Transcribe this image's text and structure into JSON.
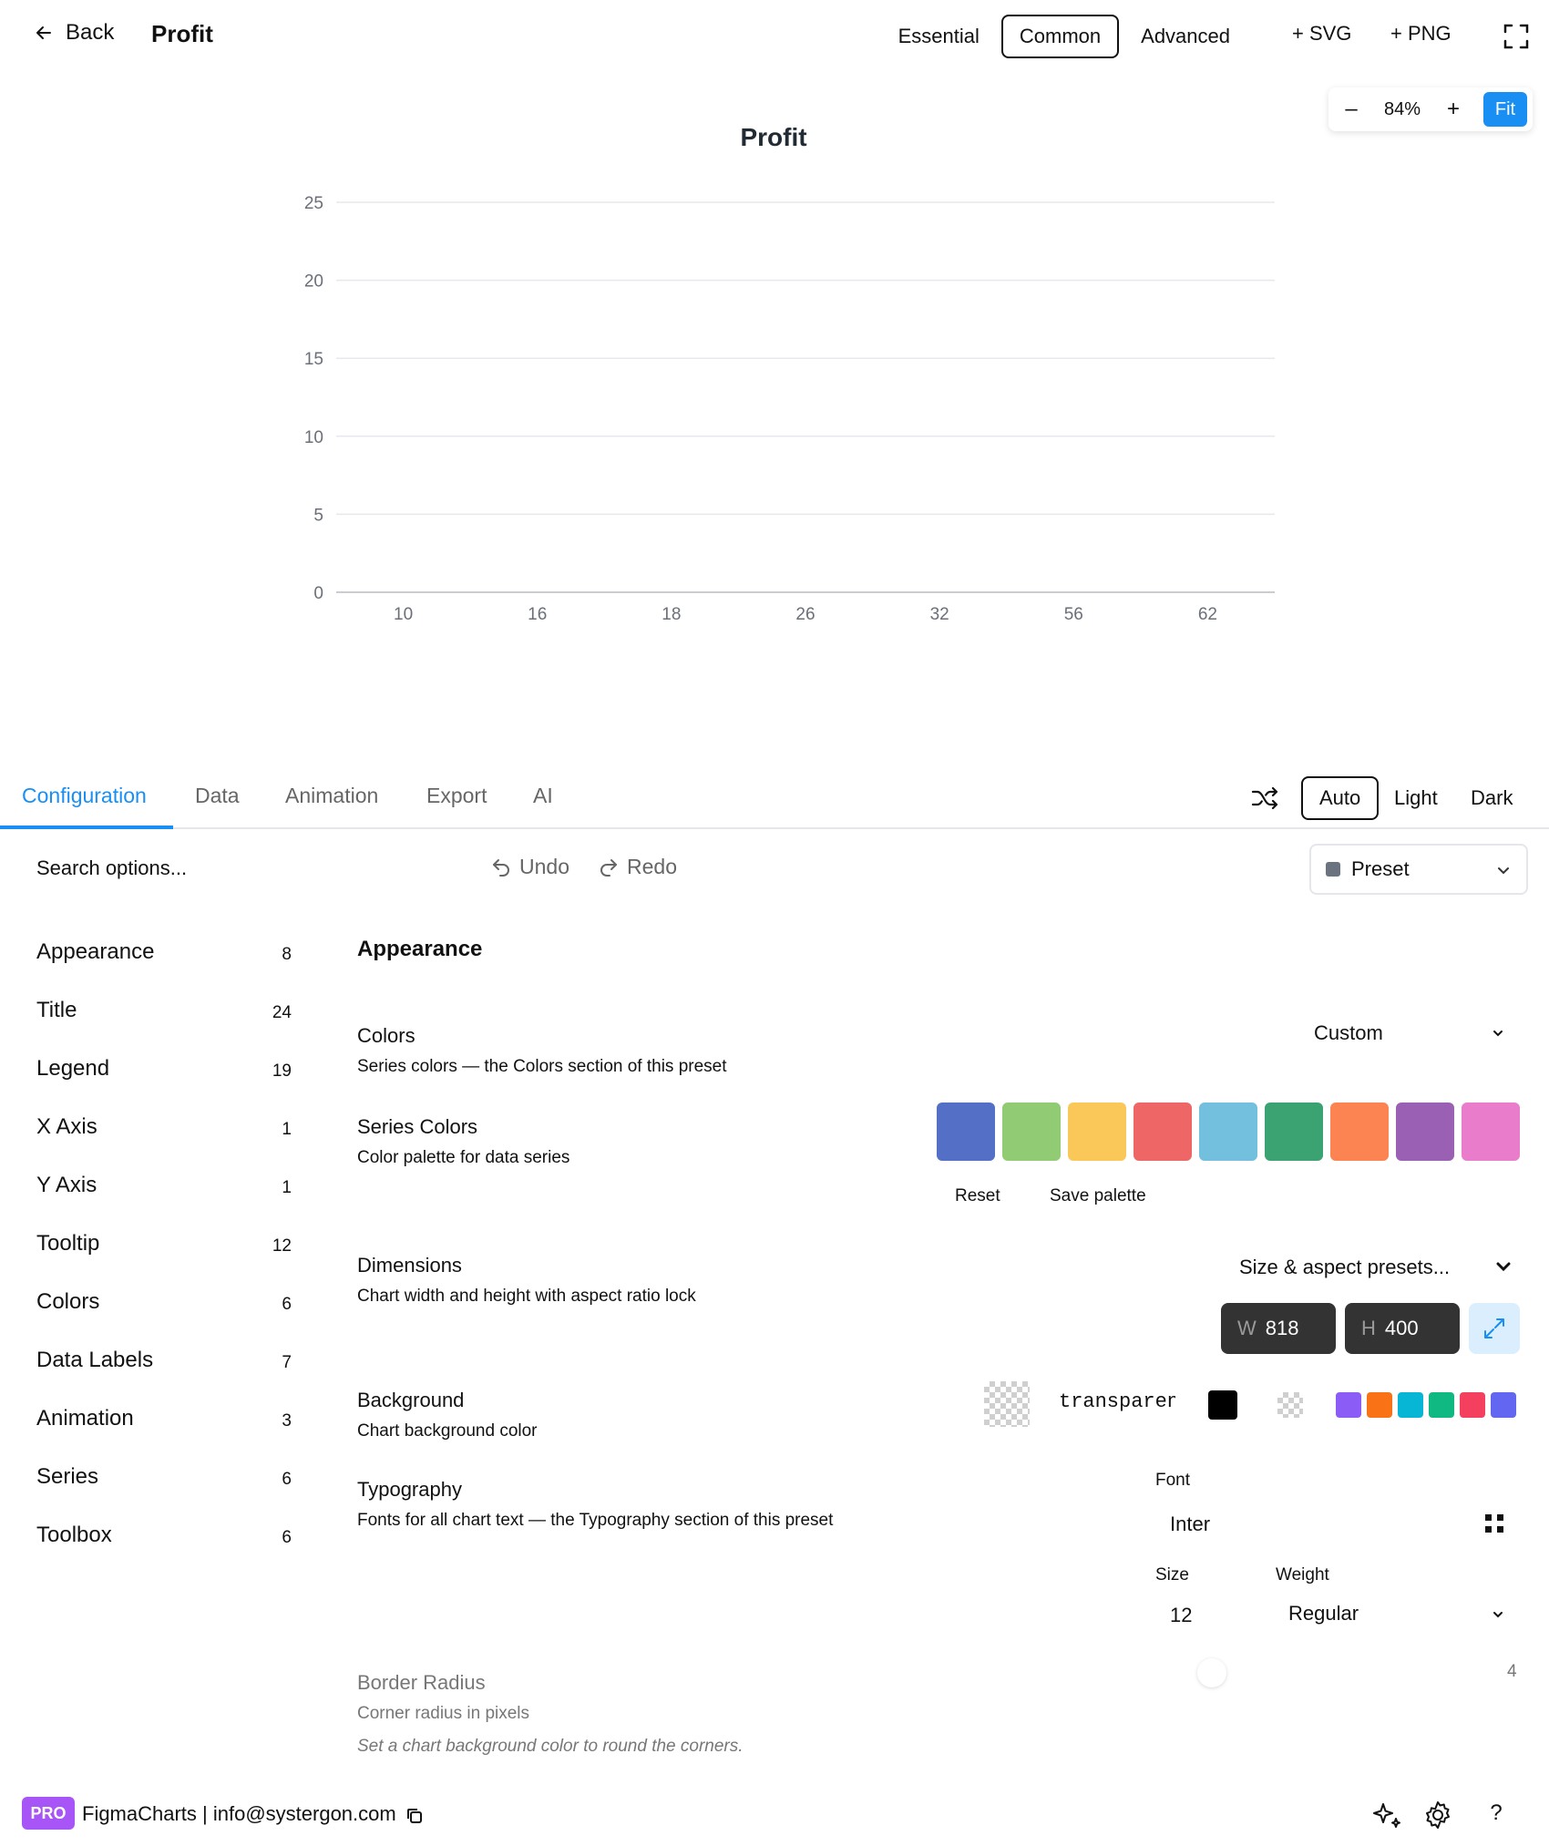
{
  "header": {
    "back_label": "Back",
    "chart_name": "Profit",
    "modes": [
      "Essential",
      "Common",
      "Advanced"
    ],
    "active_mode": "Common",
    "export_svg": "+ SVG",
    "export_png": "+ PNG"
  },
  "zoom": {
    "minus": "–",
    "value": "84%",
    "plus": "+",
    "fit": "Fit"
  },
  "chart_data": {
    "type": "bar",
    "title": "Profit",
    "categories": [
      "10",
      "16",
      "18",
      "26",
      "32",
      "56",
      "62"
    ],
    "values": [
      0,
      0,
      0,
      0,
      0,
      0,
      0
    ],
    "ylim": [
      0,
      25
    ],
    "yticks": [
      "0",
      "5",
      "10",
      "15",
      "20",
      "25"
    ],
    "grid": true
  },
  "panel": {
    "tabs": [
      "Configuration",
      "Data",
      "Animation",
      "Export",
      "AI"
    ],
    "active_tab": "Configuration",
    "themes": [
      "Auto",
      "Light",
      "Dark"
    ],
    "active_theme": "Auto"
  },
  "toolbar": {
    "search_placeholder": "Search options...",
    "undo": "Undo",
    "redo": "Redo",
    "preset": "Preset"
  },
  "sidebar": {
    "items": [
      {
        "label": "Appearance",
        "count": "8"
      },
      {
        "label": "Title",
        "count": "24"
      },
      {
        "label": "Legend",
        "count": "19"
      },
      {
        "label": "X Axis",
        "count": "1"
      },
      {
        "label": "Y Axis",
        "count": "1"
      },
      {
        "label": "Tooltip",
        "count": "12"
      },
      {
        "label": "Colors",
        "count": "6"
      },
      {
        "label": "Data Labels",
        "count": "7"
      },
      {
        "label": "Animation",
        "count": "3"
      },
      {
        "label": "Series",
        "count": "6"
      },
      {
        "label": "Toolbox",
        "count": "6"
      }
    ]
  },
  "settings": {
    "section_title": "Appearance",
    "colors": {
      "label": "Colors",
      "desc": "Series colors — the Colors section of this preset",
      "value": "Custom"
    },
    "series_colors": {
      "label": "Series Colors",
      "desc": "Color palette for data series",
      "palette": [
        "#5470c6",
        "#91cc75",
        "#fac858",
        "#ee6666",
        "#73c0de",
        "#3ba272",
        "#fc8452",
        "#9a60b4",
        "#ea7ccc"
      ],
      "reset": "Reset",
      "save": "Save palette"
    },
    "dimensions": {
      "label": "Dimensions",
      "desc": "Chart width and height with aspect ratio lock",
      "presets": "Size & aspect presets...",
      "w_label": "W",
      "width": "818",
      "h_label": "H",
      "height": "400"
    },
    "background": {
      "label": "Background",
      "desc": "Chart background color",
      "value": "transparent",
      "quick_colors": [
        "#8b5cf6",
        "#f97316",
        "#06b6d4",
        "#10b981",
        "#f43f5e",
        "#6366f1"
      ]
    },
    "typography": {
      "label": "Typography",
      "desc": "Fonts for all chart text — the Typography section of this preset",
      "font_label": "Font",
      "font": "Inter",
      "size_label": "Size",
      "size": "12",
      "weight_label": "Weight",
      "weight": "Regular"
    },
    "border_radius": {
      "label": "Border Radius",
      "desc": "Corner radius in pixels",
      "hint": "Set a chart background color to round the corners.",
      "value": "4"
    }
  },
  "footer": {
    "badge": "PRO",
    "text": "FigmaCharts | info@systergon.com"
  }
}
